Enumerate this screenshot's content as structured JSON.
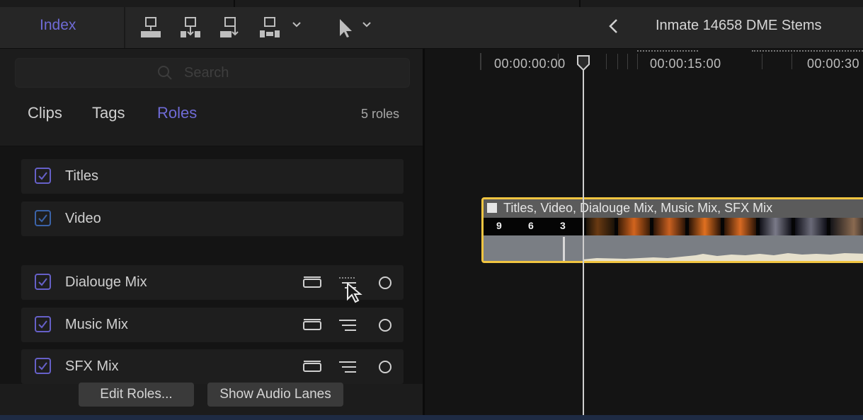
{
  "toolbar": {
    "index_label": "Index",
    "icons": [
      "connect-clip-icon",
      "insert-clip-icon",
      "append-clip-icon",
      "overwrite-clip-icon",
      "edit-options-chevron-icon",
      "select-tool-icon",
      "tool-menu-chevron-icon"
    ],
    "back_icon": "chevron-left-icon",
    "project_title": "Inmate 14658 DME Stems"
  },
  "sidebar": {
    "search": {
      "placeholder": "Search",
      "value": ""
    },
    "tabs": [
      {
        "label": "Clips",
        "active": false
      },
      {
        "label": "Tags",
        "active": false
      },
      {
        "label": "Roles",
        "active": true
      }
    ],
    "count_label": "5 roles",
    "roles": [
      {
        "name": "Titles",
        "checked": true,
        "type": "video"
      },
      {
        "name": "Video",
        "checked": true,
        "type": "video"
      },
      {
        "name": "Dialouge Mix",
        "checked": true,
        "type": "audio"
      },
      {
        "name": "Music Mix",
        "checked": true,
        "type": "audio"
      },
      {
        "name": "SFX Mix",
        "checked": true,
        "type": "audio"
      }
    ],
    "buttons": {
      "edit_roles": "Edit Roles...",
      "show_lanes": "Show Audio Lanes"
    }
  },
  "timeline": {
    "ruler_labels": [
      "00:00:00:00",
      "00:00:15:00",
      "00:00:30"
    ],
    "clip": {
      "title": "Titles, Video, Dialouge Mix, Music Mix, SFX Mix",
      "countdown": [
        "9",
        "6",
        "3"
      ],
      "selected": true
    }
  },
  "colors": {
    "accent": "#6f6bd6",
    "selection": "#f1c541",
    "background": "#141414"
  }
}
